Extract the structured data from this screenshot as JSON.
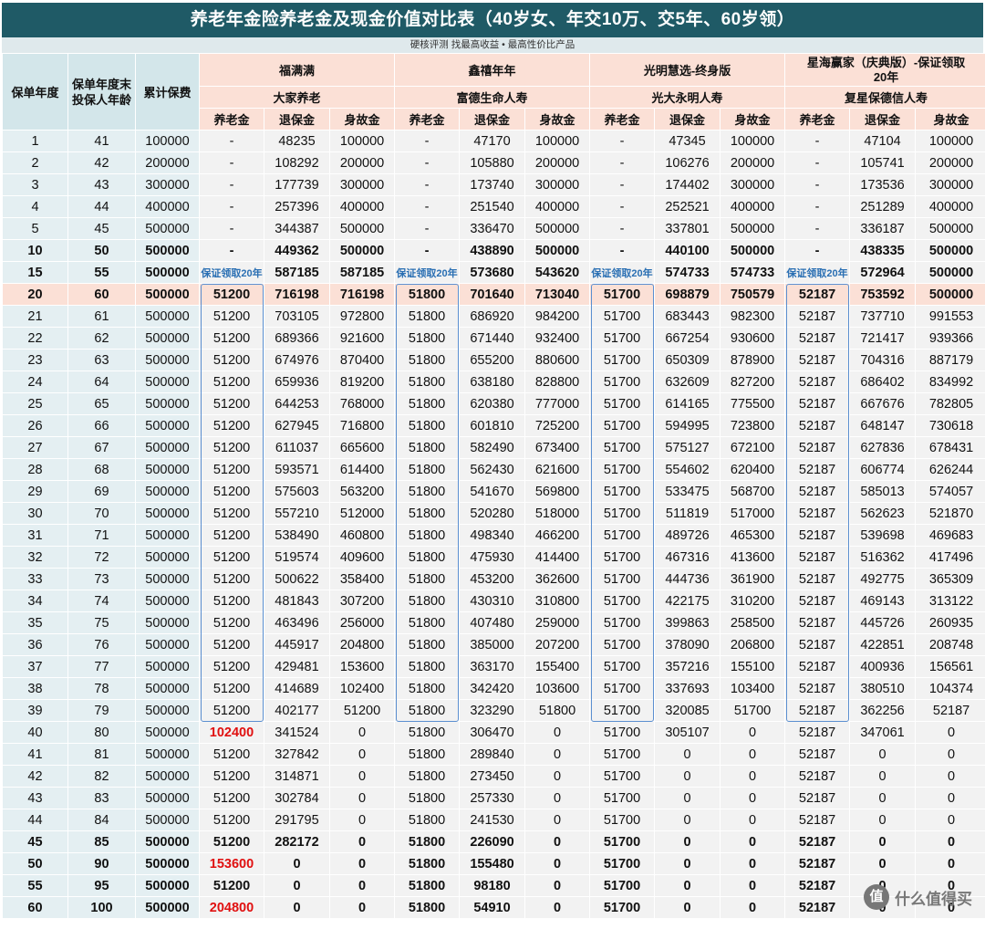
{
  "title": "养老年金险养老金及现金价值对比表（40岁女、年交10万、交5年、60岁领）",
  "subtitle": "硬核评测  找最高收益 • 最高性价比产品",
  "headers": {
    "policy_year": "保单年度",
    "age": "保单年度末投保人年龄",
    "premium": "累计保费",
    "pension": "养老金",
    "surrender": "退保金",
    "death": "身故金"
  },
  "products": [
    {
      "name": "福满满",
      "company": "大家养老",
      "note": "保证领取20年"
    },
    {
      "name": "鑫禧年年",
      "company": "富德生命人寿",
      "note": "保证领取20年"
    },
    {
      "name": "光明慧选-终身版",
      "company": "光大永明人寿",
      "note": "保证领取20年"
    },
    {
      "name": "星海赢家（庆典版）-保证领取20年",
      "company": "复星保德信人寿",
      "note": "保证领取20年"
    }
  ],
  "rows": [
    [
      "1",
      "41",
      "100000",
      "-",
      "48235",
      "100000",
      "-",
      "47170",
      "100000",
      "-",
      "47345",
      "100000",
      "-",
      "47104",
      "100000"
    ],
    [
      "2",
      "42",
      "200000",
      "-",
      "108292",
      "200000",
      "-",
      "105880",
      "200000",
      "-",
      "106276",
      "200000",
      "-",
      "105741",
      "200000"
    ],
    [
      "3",
      "43",
      "300000",
      "-",
      "177739",
      "300000",
      "-",
      "173740",
      "300000",
      "-",
      "174402",
      "300000",
      "-",
      "173536",
      "300000"
    ],
    [
      "4",
      "44",
      "400000",
      "-",
      "257396",
      "400000",
      "-",
      "251540",
      "400000",
      "-",
      "252521",
      "400000",
      "-",
      "251289",
      "400000"
    ],
    [
      "5",
      "45",
      "500000",
      "-",
      "344387",
      "500000",
      "-",
      "336470",
      "500000",
      "-",
      "337801",
      "500000",
      "-",
      "336187",
      "500000"
    ],
    [
      "10",
      "50",
      "500000",
      "-",
      "449362",
      "500000",
      "-",
      "438890",
      "500000",
      "-",
      "440100",
      "500000",
      "-",
      "438335",
      "500000"
    ],
    [
      "15",
      "55",
      "500000",
      "",
      "587185",
      "587185",
      "",
      "573680",
      "543620",
      "",
      "574733",
      "574733",
      "",
      "572964",
      "500000"
    ],
    [
      "20",
      "60",
      "500000",
      "51200",
      "716198",
      "716198",
      "51800",
      "701640",
      "713040",
      "51700",
      "698879",
      "750579",
      "52187",
      "753592",
      "500000"
    ],
    [
      "21",
      "61",
      "500000",
      "51200",
      "703105",
      "972800",
      "51800",
      "686920",
      "984200",
      "51700",
      "683443",
      "982300",
      "52187",
      "737710",
      "991553"
    ],
    [
      "22",
      "62",
      "500000",
      "51200",
      "689366",
      "921600",
      "51800",
      "671440",
      "932400",
      "51700",
      "667254",
      "930600",
      "52187",
      "721417",
      "939366"
    ],
    [
      "23",
      "63",
      "500000",
      "51200",
      "674976",
      "870400",
      "51800",
      "655200",
      "880600",
      "51700",
      "650309",
      "878900",
      "52187",
      "704316",
      "887179"
    ],
    [
      "24",
      "64",
      "500000",
      "51200",
      "659936",
      "819200",
      "51800",
      "638180",
      "828800",
      "51700",
      "632609",
      "827200",
      "52187",
      "686402",
      "834992"
    ],
    [
      "25",
      "65",
      "500000",
      "51200",
      "644253",
      "768000",
      "51800",
      "620380",
      "777000",
      "51700",
      "614165",
      "775500",
      "52187",
      "667676",
      "782805"
    ],
    [
      "26",
      "66",
      "500000",
      "51200",
      "627945",
      "716800",
      "51800",
      "601810",
      "725200",
      "51700",
      "594995",
      "723800",
      "52187",
      "648147",
      "730618"
    ],
    [
      "27",
      "67",
      "500000",
      "51200",
      "611037",
      "665600",
      "51800",
      "582490",
      "673400",
      "51700",
      "575127",
      "672100",
      "52187",
      "627836",
      "678431"
    ],
    [
      "28",
      "68",
      "500000",
      "51200",
      "593571",
      "614400",
      "51800",
      "562430",
      "621600",
      "51700",
      "554602",
      "620400",
      "52187",
      "606774",
      "626244"
    ],
    [
      "29",
      "69",
      "500000",
      "51200",
      "575603",
      "563200",
      "51800",
      "541670",
      "569800",
      "51700",
      "533475",
      "568700",
      "52187",
      "585013",
      "574057"
    ],
    [
      "30",
      "70",
      "500000",
      "51200",
      "557210",
      "512000",
      "51800",
      "520280",
      "518000",
      "51700",
      "511819",
      "517000",
      "52187",
      "562623",
      "521870"
    ],
    [
      "31",
      "71",
      "500000",
      "51200",
      "538490",
      "460800",
      "51800",
      "498340",
      "466200",
      "51700",
      "489726",
      "465300",
      "52187",
      "539698",
      "469683"
    ],
    [
      "32",
      "72",
      "500000",
      "51200",
      "519574",
      "409600",
      "51800",
      "475930",
      "414400",
      "51700",
      "467316",
      "413600",
      "52187",
      "516362",
      "417496"
    ],
    [
      "33",
      "73",
      "500000",
      "51200",
      "500622",
      "358400",
      "51800",
      "453200",
      "362600",
      "51700",
      "444736",
      "361900",
      "52187",
      "492775",
      "365309"
    ],
    [
      "34",
      "74",
      "500000",
      "51200",
      "481843",
      "307200",
      "51800",
      "430310",
      "310800",
      "51700",
      "422175",
      "310200",
      "52187",
      "469143",
      "313122"
    ],
    [
      "35",
      "75",
      "500000",
      "51200",
      "463496",
      "256000",
      "51800",
      "407480",
      "259000",
      "51700",
      "399863",
      "258500",
      "52187",
      "445726",
      "260935"
    ],
    [
      "36",
      "76",
      "500000",
      "51200",
      "445917",
      "204800",
      "51800",
      "385000",
      "207200",
      "51700",
      "378090",
      "206800",
      "52187",
      "422851",
      "208748"
    ],
    [
      "37",
      "77",
      "500000",
      "51200",
      "429481",
      "153600",
      "51800",
      "363170",
      "155400",
      "51700",
      "357216",
      "155100",
      "52187",
      "400936",
      "156561"
    ],
    [
      "38",
      "78",
      "500000",
      "51200",
      "414689",
      "102400",
      "51800",
      "342420",
      "103600",
      "51700",
      "337693",
      "103400",
      "52187",
      "380510",
      "104374"
    ],
    [
      "39",
      "79",
      "500000",
      "51200",
      "402177",
      "51200",
      "51800",
      "323290",
      "51800",
      "51700",
      "320085",
      "51700",
      "52187",
      "362256",
      "52187"
    ],
    [
      "40",
      "80",
      "500000",
      "102400",
      "341524",
      "0",
      "51800",
      "306470",
      "0",
      "51700",
      "305107",
      "0",
      "52187",
      "347061",
      "0"
    ],
    [
      "41",
      "81",
      "500000",
      "51200",
      "327842",
      "0",
      "51800",
      "289840",
      "0",
      "51700",
      "0",
      "0",
      "52187",
      "0",
      "0"
    ],
    [
      "42",
      "82",
      "500000",
      "51200",
      "314871",
      "0",
      "51800",
      "273450",
      "0",
      "51700",
      "0",
      "0",
      "52187",
      "0",
      "0"
    ],
    [
      "43",
      "83",
      "500000",
      "51200",
      "302784",
      "0",
      "51800",
      "257330",
      "0",
      "51700",
      "0",
      "0",
      "52187",
      "0",
      "0"
    ],
    [
      "44",
      "84",
      "500000",
      "51200",
      "291795",
      "0",
      "51800",
      "241530",
      "0",
      "51700",
      "0",
      "0",
      "52187",
      "0",
      "0"
    ],
    [
      "45",
      "85",
      "500000",
      "51200",
      "282172",
      "0",
      "51800",
      "226090",
      "0",
      "51700",
      "0",
      "0",
      "52187",
      "0",
      "0"
    ],
    [
      "50",
      "90",
      "500000",
      "153600",
      "0",
      "0",
      "51800",
      "155480",
      "0",
      "51700",
      "0",
      "0",
      "52187",
      "0",
      "0"
    ],
    [
      "55",
      "95",
      "500000",
      "51200",
      "0",
      "0",
      "51800",
      "98180",
      "0",
      "51700",
      "0",
      "0",
      "52187",
      "0",
      "0"
    ],
    [
      "60",
      "100",
      "500000",
      "204800",
      "0",
      "0",
      "51800",
      "54910",
      "0",
      "51700",
      "0",
      "0",
      "52187",
      "0",
      "0"
    ]
  ],
  "bold_row_indices": [
    5,
    6,
    7,
    32,
    33,
    34,
    35
  ],
  "highlight_row_index": 7,
  "red_cells": [
    [
      27,
      3
    ],
    [
      33,
      3
    ],
    [
      35,
      3
    ]
  ],
  "watermark": "什么值得买",
  "watermark_badge": "值"
}
